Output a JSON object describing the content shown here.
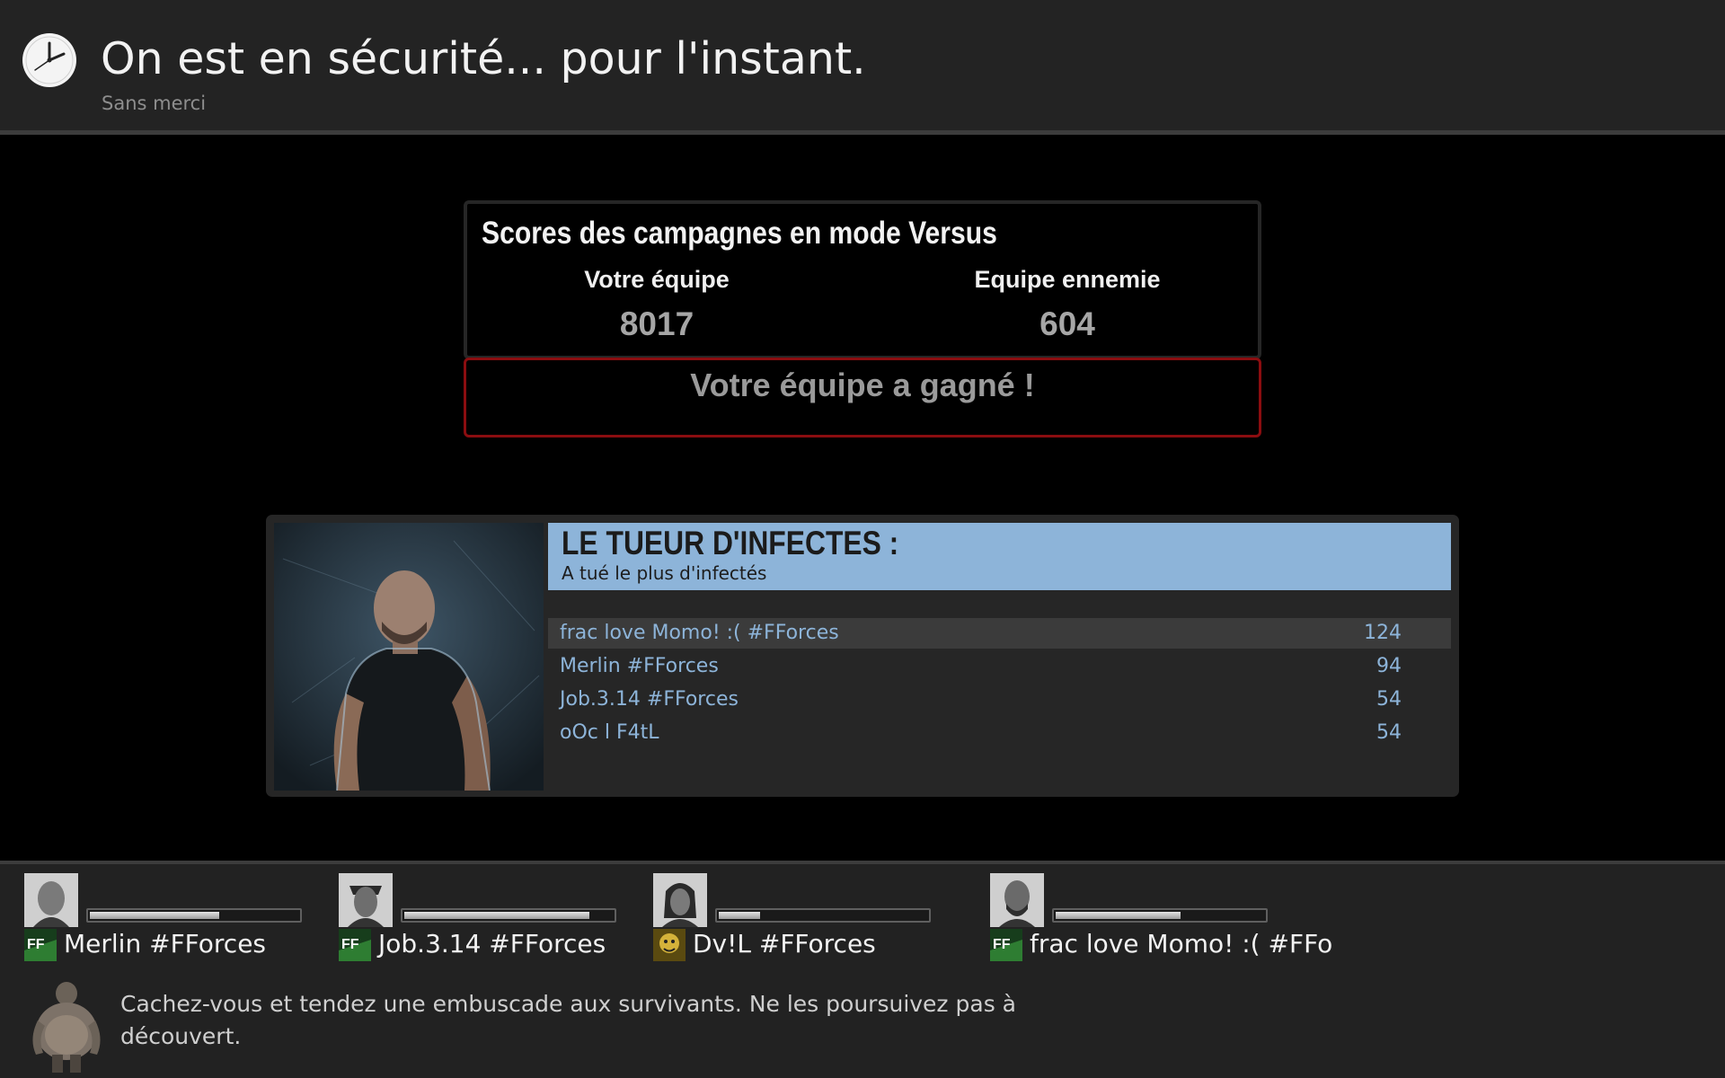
{
  "header": {
    "title": "On est en sécurité... pour l'instant.",
    "subtitle": "Sans merci",
    "icon": "clock-icon"
  },
  "versus": {
    "title": "Scores des campagnes en mode Versus",
    "your_team_label": "Votre équipe",
    "your_team_score": "8017",
    "enemy_team_label": "Equipe ennemie",
    "enemy_team_score": "604",
    "result": "Votre équipe a gagné !",
    "result_border_color": "#8b0d10"
  },
  "award": {
    "title": "LE TUEUR D'INFECTES :",
    "subtitle": "A tué le plus d'infectés",
    "accent_color": "#8db4d9",
    "rows": [
      {
        "player": "frac love Momo! :( #FForces",
        "kills": "124"
      },
      {
        "player": "Merlin #FForces",
        "kills": "94"
      },
      {
        "player": "Job.3.14 #FForces",
        "kills": "54"
      },
      {
        "player": "oOc l F4tL",
        "kills": "54"
      }
    ]
  },
  "team": [
    {
      "name": "Merlin #FForces",
      "health": 0.62,
      "badge": "FF"
    },
    {
      "name": "Job.3.14 #FForces",
      "health": 0.89,
      "badge": "FF"
    },
    {
      "name": "Dv!L #FForces",
      "health": 0.2,
      "badge": ""
    },
    {
      "name": "frac love Momo! :( #FFo",
      "health": 0.6,
      "badge": "FF"
    }
  ],
  "tip": {
    "text": "Cachez-vous et tendez une embuscade aux survivants. Ne les poursuivez pas à découvert.",
    "icon": "boomer-icon"
  }
}
